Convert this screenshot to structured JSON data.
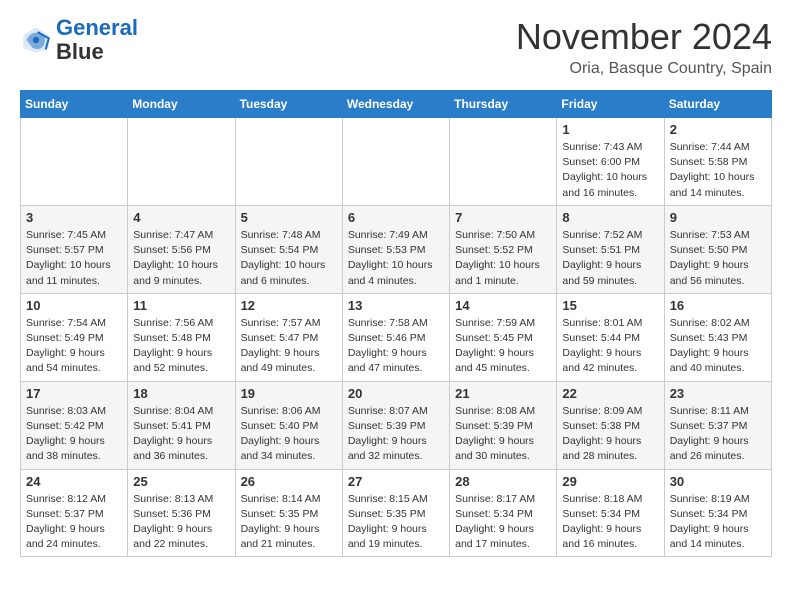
{
  "logo": {
    "line1": "General",
    "line2": "Blue"
  },
  "title": "November 2024",
  "location": "Oria, Basque Country, Spain",
  "days_header": [
    "Sunday",
    "Monday",
    "Tuesday",
    "Wednesday",
    "Thursday",
    "Friday",
    "Saturday"
  ],
  "weeks": [
    [
      {
        "day": "",
        "info": ""
      },
      {
        "day": "",
        "info": ""
      },
      {
        "day": "",
        "info": ""
      },
      {
        "day": "",
        "info": ""
      },
      {
        "day": "",
        "info": ""
      },
      {
        "day": "1",
        "info": "Sunrise: 7:43 AM\nSunset: 6:00 PM\nDaylight: 10 hours and 16 minutes."
      },
      {
        "day": "2",
        "info": "Sunrise: 7:44 AM\nSunset: 5:58 PM\nDaylight: 10 hours and 14 minutes."
      }
    ],
    [
      {
        "day": "3",
        "info": "Sunrise: 7:45 AM\nSunset: 5:57 PM\nDaylight: 10 hours and 11 minutes."
      },
      {
        "day": "4",
        "info": "Sunrise: 7:47 AM\nSunset: 5:56 PM\nDaylight: 10 hours and 9 minutes."
      },
      {
        "day": "5",
        "info": "Sunrise: 7:48 AM\nSunset: 5:54 PM\nDaylight: 10 hours and 6 minutes."
      },
      {
        "day": "6",
        "info": "Sunrise: 7:49 AM\nSunset: 5:53 PM\nDaylight: 10 hours and 4 minutes."
      },
      {
        "day": "7",
        "info": "Sunrise: 7:50 AM\nSunset: 5:52 PM\nDaylight: 10 hours and 1 minute."
      },
      {
        "day": "8",
        "info": "Sunrise: 7:52 AM\nSunset: 5:51 PM\nDaylight: 9 hours and 59 minutes."
      },
      {
        "day": "9",
        "info": "Sunrise: 7:53 AM\nSunset: 5:50 PM\nDaylight: 9 hours and 56 minutes."
      }
    ],
    [
      {
        "day": "10",
        "info": "Sunrise: 7:54 AM\nSunset: 5:49 PM\nDaylight: 9 hours and 54 minutes."
      },
      {
        "day": "11",
        "info": "Sunrise: 7:56 AM\nSunset: 5:48 PM\nDaylight: 9 hours and 52 minutes."
      },
      {
        "day": "12",
        "info": "Sunrise: 7:57 AM\nSunset: 5:47 PM\nDaylight: 9 hours and 49 minutes."
      },
      {
        "day": "13",
        "info": "Sunrise: 7:58 AM\nSunset: 5:46 PM\nDaylight: 9 hours and 47 minutes."
      },
      {
        "day": "14",
        "info": "Sunrise: 7:59 AM\nSunset: 5:45 PM\nDaylight: 9 hours and 45 minutes."
      },
      {
        "day": "15",
        "info": "Sunrise: 8:01 AM\nSunset: 5:44 PM\nDaylight: 9 hours and 42 minutes."
      },
      {
        "day": "16",
        "info": "Sunrise: 8:02 AM\nSunset: 5:43 PM\nDaylight: 9 hours and 40 minutes."
      }
    ],
    [
      {
        "day": "17",
        "info": "Sunrise: 8:03 AM\nSunset: 5:42 PM\nDaylight: 9 hours and 38 minutes."
      },
      {
        "day": "18",
        "info": "Sunrise: 8:04 AM\nSunset: 5:41 PM\nDaylight: 9 hours and 36 minutes."
      },
      {
        "day": "19",
        "info": "Sunrise: 8:06 AM\nSunset: 5:40 PM\nDaylight: 9 hours and 34 minutes."
      },
      {
        "day": "20",
        "info": "Sunrise: 8:07 AM\nSunset: 5:39 PM\nDaylight: 9 hours and 32 minutes."
      },
      {
        "day": "21",
        "info": "Sunrise: 8:08 AM\nSunset: 5:39 PM\nDaylight: 9 hours and 30 minutes."
      },
      {
        "day": "22",
        "info": "Sunrise: 8:09 AM\nSunset: 5:38 PM\nDaylight: 9 hours and 28 minutes."
      },
      {
        "day": "23",
        "info": "Sunrise: 8:11 AM\nSunset: 5:37 PM\nDaylight: 9 hours and 26 minutes."
      }
    ],
    [
      {
        "day": "24",
        "info": "Sunrise: 8:12 AM\nSunset: 5:37 PM\nDaylight: 9 hours and 24 minutes."
      },
      {
        "day": "25",
        "info": "Sunrise: 8:13 AM\nSunset: 5:36 PM\nDaylight: 9 hours and 22 minutes."
      },
      {
        "day": "26",
        "info": "Sunrise: 8:14 AM\nSunset: 5:35 PM\nDaylight: 9 hours and 21 minutes."
      },
      {
        "day": "27",
        "info": "Sunrise: 8:15 AM\nSunset: 5:35 PM\nDaylight: 9 hours and 19 minutes."
      },
      {
        "day": "28",
        "info": "Sunrise: 8:17 AM\nSunset: 5:34 PM\nDaylight: 9 hours and 17 minutes."
      },
      {
        "day": "29",
        "info": "Sunrise: 8:18 AM\nSunset: 5:34 PM\nDaylight: 9 hours and 16 minutes."
      },
      {
        "day": "30",
        "info": "Sunrise: 8:19 AM\nSunset: 5:34 PM\nDaylight: 9 hours and 14 minutes."
      }
    ]
  ]
}
